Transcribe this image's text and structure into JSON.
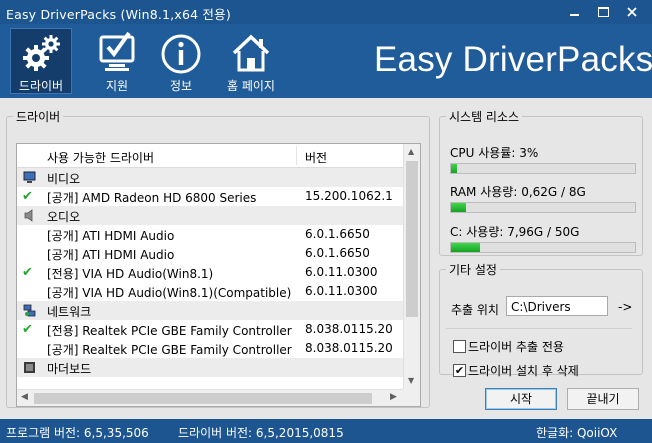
{
  "window": {
    "title": "Easy DriverPacks (Win8.1,x64 전용)"
  },
  "nav": [
    {
      "label": "드라이버",
      "icon": "gears-icon",
      "active": true
    },
    {
      "label": "지원",
      "icon": "checkmark-monitor-icon",
      "active": false
    },
    {
      "label": "정보",
      "icon": "info-icon",
      "active": false
    },
    {
      "label": "홈 페이지",
      "icon": "home-icon",
      "active": false
    }
  ],
  "brand": "Easy DriverPacks",
  "drivers": {
    "group_title": "드라이버",
    "columns": [
      "사용 가능한 드라이버",
      "버전"
    ],
    "rows": [
      {
        "type": "group",
        "name": "비디오",
        "icon": "monitor-icon"
      },
      {
        "type": "item",
        "name": "[공개] AMD Radeon HD 6800 Series",
        "version": "15.200.1062.1",
        "checked": true
      },
      {
        "type": "group",
        "name": "오디오",
        "icon": "speaker-icon"
      },
      {
        "type": "item",
        "name": "[공개] ATI HDMI Audio",
        "version": "6.0.1.6650",
        "checked": false
      },
      {
        "type": "item",
        "name": "[공개] ATI HDMI Audio",
        "version": "6.0.1.6650",
        "checked": false
      },
      {
        "type": "item",
        "name": "[전용] VIA HD Audio(Win8.1)",
        "version": "6.0.11.0300",
        "checked": true
      },
      {
        "type": "item",
        "name": "[공개] VIA HD Audio(Win8.1)(Compatible)",
        "version": "6.0.11.0300",
        "checked": false
      },
      {
        "type": "group",
        "name": "네트워크",
        "icon": "network-icon"
      },
      {
        "type": "item",
        "name": "[전용] Realtek PCIe GBE Family Controller",
        "version": "8.038.0115.20",
        "checked": true
      },
      {
        "type": "item",
        "name": "[공개] Realtek PCIe GBE Family Controller",
        "version": "8.038.0115.20",
        "checked": false
      },
      {
        "type": "group",
        "name": "마더보드",
        "icon": "chip-icon"
      }
    ]
  },
  "resources": {
    "title": "시스템 리소스",
    "cpu": {
      "label": "CPU 사용률:  3%",
      "fill": 0.03
    },
    "ram": {
      "label": "RAM 사용량:  0,62G / 8G",
      "fill": 0.08
    },
    "disk": {
      "label": "C:   사용량:  7,96G / 50G",
      "fill": 0.16
    }
  },
  "settings": {
    "title": "기타 설정",
    "extract_label": "추출 위치",
    "extract_path": "C:\\Drivers",
    "browse_label": "->",
    "options": [
      {
        "label": "드라이버 추출 전용",
        "checked": false
      },
      {
        "label": "드라이버 설치 후 삭제",
        "checked": true
      }
    ]
  },
  "buttons": {
    "start": "시작",
    "exit": "끝내기"
  },
  "status": {
    "program_version": "프로그램 버전: 6,5,35,506",
    "driver_version": "드라이버 버전: 6,5,2015,0815",
    "localization": "한글화: QoiiOX"
  }
}
